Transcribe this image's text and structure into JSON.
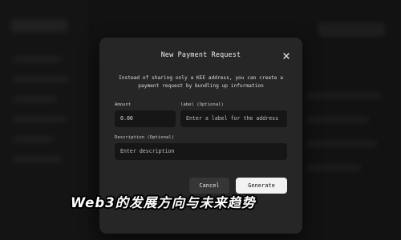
{
  "modal": {
    "title": "New Payment Request",
    "close_icon": "close-icon",
    "description": "Instead of sharing only a KEE address, you can create a payment request by bundling up information",
    "amount_label": "Amount",
    "amount_value": "0.00",
    "label_label": "label (Optional)",
    "label_placeholder": "Enter a label for the address",
    "description_label": "Description (Optional)",
    "description_placeholder": "Enter description",
    "cancel_label": "Cancel",
    "generate_label": "Generate"
  },
  "caption": "Web3的发展方向与未来趋势",
  "colors": {
    "background": "#1c1c1c",
    "modal": "#262626",
    "input": "#161616",
    "primary_button": "#f2f2f2"
  }
}
